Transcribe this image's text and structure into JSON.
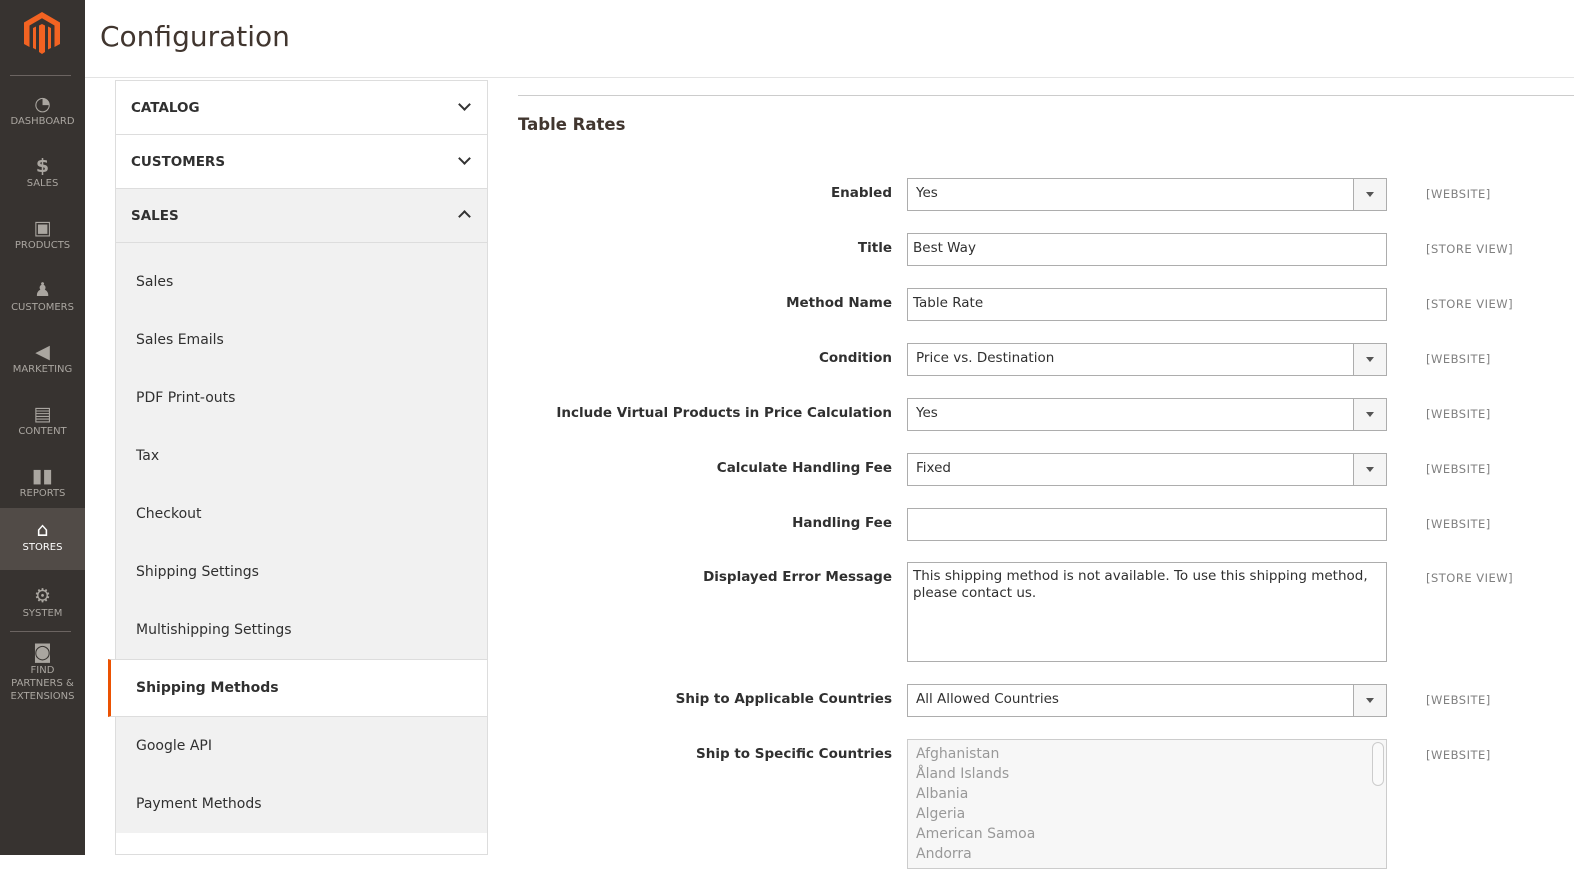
{
  "nav": [
    {
      "label": "DASHBOARD",
      "icon": "dashboard-icon"
    },
    {
      "label": "SALES",
      "icon": "dollar-icon"
    },
    {
      "label": "PRODUCTS",
      "icon": "box-icon"
    },
    {
      "label": "CUSTOMERS",
      "icon": "person-icon"
    },
    {
      "label": "MARKETING",
      "icon": "megaphone-icon"
    },
    {
      "label": "CONTENT",
      "icon": "layout-icon"
    },
    {
      "label": "REPORTS",
      "icon": "bar-chart-icon"
    },
    {
      "label": "STORES",
      "icon": "store-icon"
    },
    {
      "label": "SYSTEM",
      "icon": "gear-icon"
    },
    {
      "label": "FIND PARTNERS & EXTENSIONS",
      "icon": "blocks-icon"
    }
  ],
  "header": {
    "title": "Configuration"
  },
  "panel": {
    "sections": [
      "CATALOG",
      "CUSTOMERS",
      "SALES"
    ],
    "items": [
      "Sales",
      "Sales Emails",
      "PDF Print-outs",
      "Tax",
      "Checkout",
      "Shipping Settings",
      "Multishipping Settings",
      "Shipping Methods",
      "Google API",
      "Payment Methods"
    ]
  },
  "form": {
    "title": "Table Rates",
    "fields": [
      {
        "label": "Enabled",
        "value": "Yes",
        "scope": "[WEBSITE]"
      },
      {
        "label": "Title",
        "value": "Best Way",
        "scope": "[STORE VIEW]"
      },
      {
        "label": "Method Name",
        "value": "Table Rate",
        "scope": "[STORE VIEW]"
      },
      {
        "label": "Condition",
        "value": "Price vs. Destination",
        "scope": "[WEBSITE]"
      },
      {
        "label": "Include Virtual Products in Price Calculation",
        "value": "Yes",
        "scope": "[WEBSITE]"
      },
      {
        "label": "Calculate Handling Fee",
        "value": "Fixed",
        "scope": "[WEBSITE]"
      },
      {
        "label": "Handling Fee",
        "value": "",
        "scope": "[WEBSITE]"
      },
      {
        "label": "Displayed Error Message",
        "value": "This shipping method is not available. To use this shipping method, please contact us.",
        "scope": "[STORE VIEW]"
      },
      {
        "label": "Ship to Applicable Countries",
        "value": "All Allowed Countries",
        "scope": "[WEBSITE]"
      },
      {
        "label": "Ship to Specific Countries",
        "options": [
          "Afghanistan",
          "Åland Islands",
          "Albania",
          "Algeria",
          "American Samoa",
          "Andorra"
        ],
        "scope": "[WEBSITE]"
      }
    ]
  }
}
